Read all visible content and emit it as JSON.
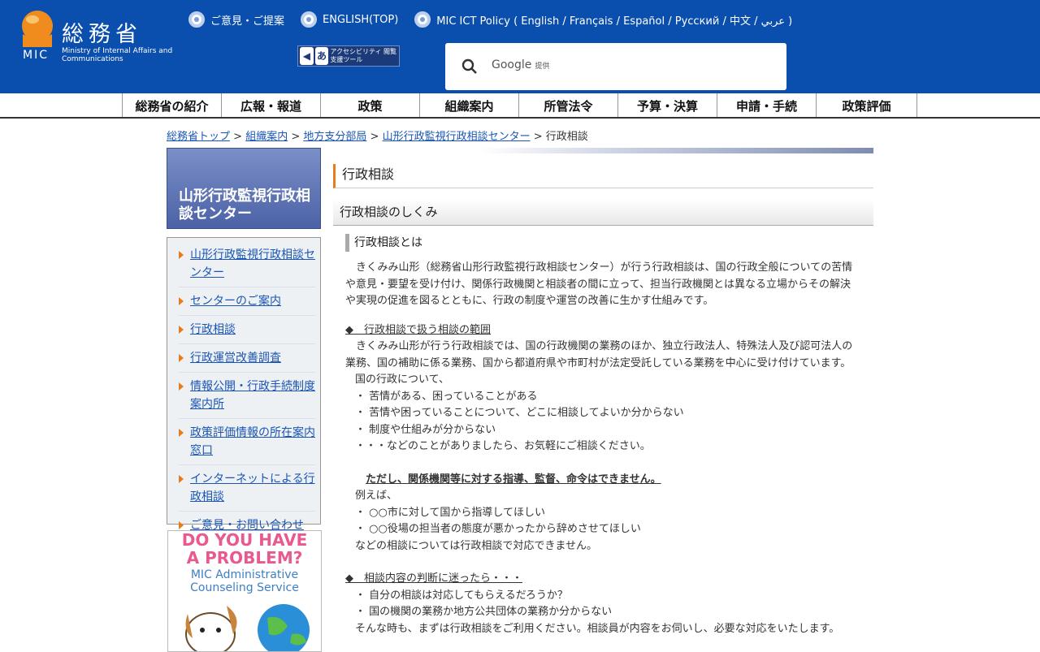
{
  "header": {
    "logo_jp": "総務省",
    "logo_mic": "MIC",
    "logo_en": "Ministry of Internal Affairs and Communications",
    "toplinks": [
      "ご意見・ご提案",
      "ENGLISH(TOP)",
      "MIC ICT Policy ( English / Français / Español / Русский / 中文 / عربي )"
    ],
    "access_label": "アクセシビリティ 閲覧支援ツール",
    "search_brand": "Google",
    "search_suffix": "提供"
  },
  "gnav": [
    "総務省の紹介",
    "広報・報道",
    "政策",
    "組織案内",
    "所管法令",
    "予算・決算",
    "申請・手続",
    "政策評価"
  ],
  "breadcrumb": {
    "links": [
      "総務省トップ",
      "組織案内",
      "地方支分部局",
      "山形行政監視行政相談センター"
    ],
    "current": "行政相談"
  },
  "sidebar": {
    "title": "山形行政監視行政相談センター",
    "items": [
      "山形行政監視行政相談センター",
      "センターのご案内",
      "行政相談",
      "行政運営改善調査",
      "情報公開・行政手続制度案内所",
      "政策評価情報の所在案内窓口",
      "インターネットによる行政相談",
      "ご意見・お問い合わせ"
    ],
    "banner_line1": "DO YOU HAVE",
    "banner_line2": "A PROBLEM?",
    "banner_line3": "MIC Administrative",
    "banner_line4": "Counseling Service"
  },
  "main": {
    "h1": "行政相談",
    "h2": "行政相談のしくみ",
    "h3": "行政相談とは",
    "intro": "　きくみみ山形（総務省山形行政監視行政相談センター）が行う行政相談は、国の行政全般についての苦情や意見・要望を受け付け、関係行政機関と相談者の間に立って、担当行政機関とは異なる立場からその解決や実現の促進を図るとともに、行政の制度や運営の改善に生かす仕組みです。",
    "scope_head": "◆　行政相談で扱う相談の範囲",
    "scope_text": "　きくみみ山形が行う行政相談では、国の行政機関の業務のほか、独立行政法人、特殊法人及び認可法人の業務、国の補助に係る業務、国から都道府県や市町村が法定受託している業務を中心に受け付けています。",
    "line1": "国の行政について、",
    "line2": "・ 苦情がある、困っていることがある",
    "line3": "・ 苦情や困っていることについて、どこに相談してよいか分からない",
    "line4": "・ 制度や仕組みが分からない",
    "line5": "・・・などのことがありましたら、お気軽にご相談ください。",
    "warn": "ただし、関係機関等に対する指導、監督、命令はできません。",
    "ex1": "例えば、",
    "ex2": "・ ○○市に対して国から指導してほしい",
    "ex3": "・ ○○役場の担当者の態度が悪かったから辞めさせてほしい",
    "ex4": "などの相談については行政相談で対応できません。",
    "doubt_head": "◆　相談内容の判断に迷ったら・・・",
    "d1": "・ 自分の相談は対応してもらえるだろうか？",
    "d2": "・ 国の機関の業務か地方公共団体の業務か分からない",
    "d3": "そんな時も、まずは行政相談をご利用ください。相談員が内容をお伺いし、必要な対応をいたします。"
  }
}
